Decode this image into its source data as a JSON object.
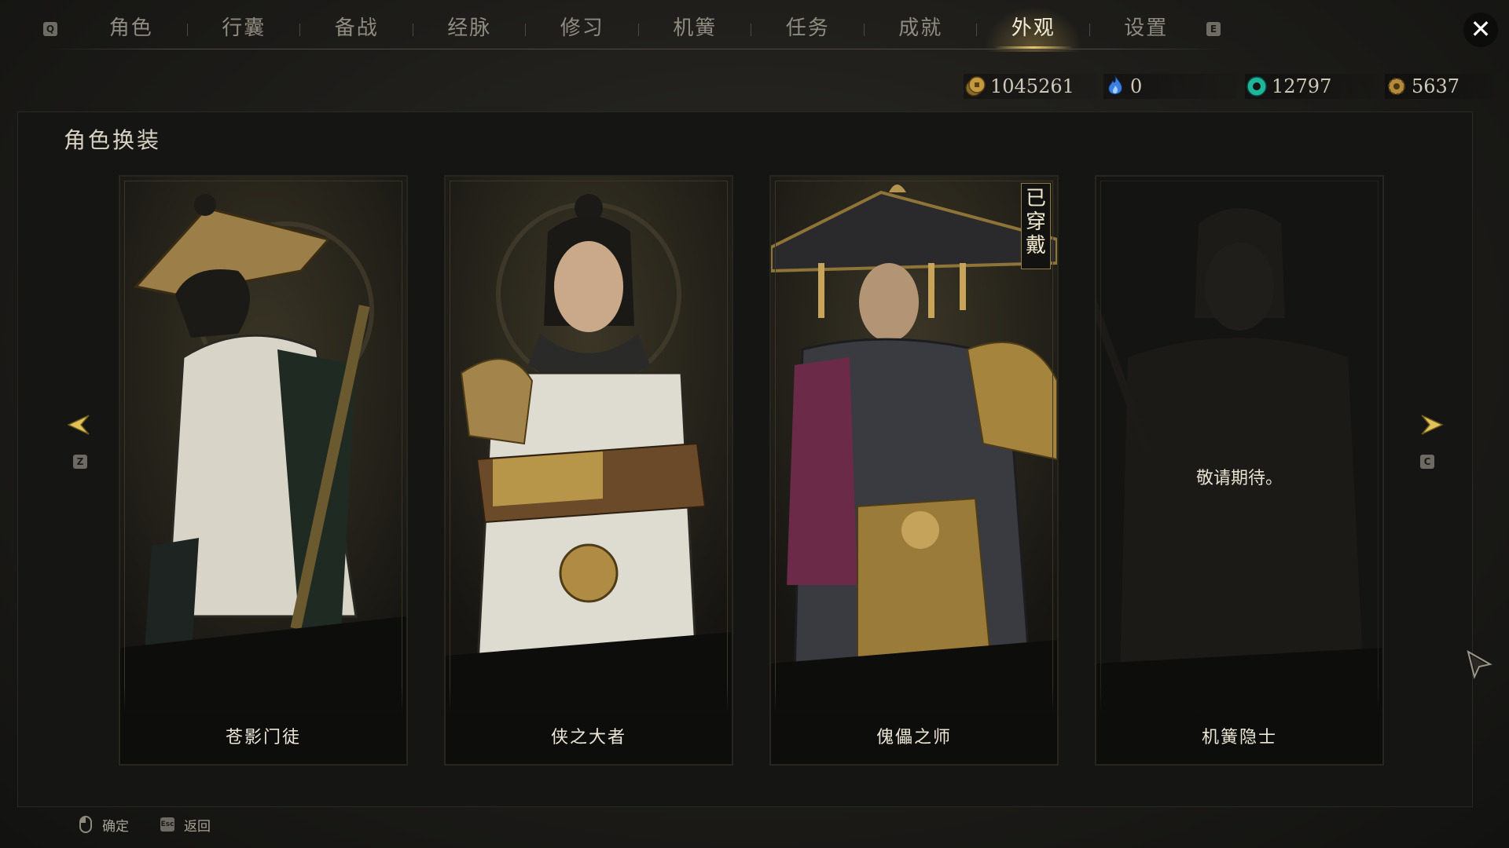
{
  "tabbar": {
    "prev_key": "Q",
    "next_key": "E",
    "tabs": [
      {
        "label": "角色"
      },
      {
        "label": "行囊"
      },
      {
        "label": "备战"
      },
      {
        "label": "经脉"
      },
      {
        "label": "修习"
      },
      {
        "label": "机簧"
      },
      {
        "label": "任务"
      },
      {
        "label": "成就"
      },
      {
        "label": "外观",
        "active": true
      },
      {
        "label": "设置"
      }
    ],
    "close_label": "✕"
  },
  "currencies": [
    {
      "icon": "copper-coin-icon",
      "value": "1045261"
    },
    {
      "icon": "blue-flame-icon",
      "value": "0"
    },
    {
      "icon": "jade-disc-icon",
      "value": "12797"
    },
    {
      "icon": "gear-ore-icon",
      "value": "5637"
    }
  ],
  "panel": {
    "title": "角色换装",
    "prev_key": "Z",
    "next_key": "C",
    "cards": [
      {
        "name": "苍影门徒",
        "locked": false,
        "equipped": false
      },
      {
        "name": "侠之大者",
        "locked": false,
        "equipped": false
      },
      {
        "name": "傀儡之师",
        "locked": false,
        "equipped": true,
        "equipped_label": "已穿戴"
      },
      {
        "name": "机簧隐士",
        "locked": true,
        "equipped": false,
        "locked_text": "敬请期待。"
      }
    ]
  },
  "footer": {
    "confirm_key": "mouse",
    "confirm_label": "确定",
    "back_key": "Esc",
    "back_label": "返回"
  },
  "colors": {
    "accent_gold": "#e6c56c",
    "active_tab_text": "#f3ead2",
    "inactive_tab_text": "#8f8b80",
    "panel_bg": "#151513"
  }
}
